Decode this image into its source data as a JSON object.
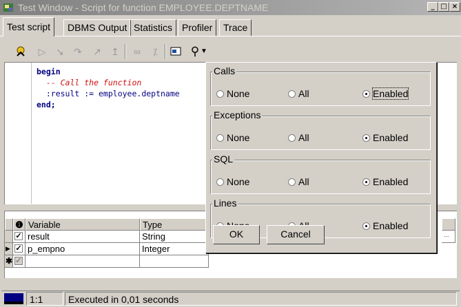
{
  "window": {
    "title": "Test Window - Script for function EMPLOYEE.DEPTNAME"
  },
  "tabs": [
    {
      "label": "Test script"
    },
    {
      "label": "DBMS Output"
    },
    {
      "label": "Statistics"
    },
    {
      "label": "Profiler"
    },
    {
      "label": "Trace"
    }
  ],
  "toolbar": {
    "icons": [
      "execute-icon",
      "run-icon",
      "step-into-icon",
      "step-over-icon",
      "step-out-icon",
      "run-to-exception-icon",
      "breakpoint-icon",
      "variables-icon",
      "trace-icon",
      "find-icon",
      "dropdown-icon"
    ]
  },
  "editor": {
    "lines": [
      {
        "text": "begin"
      },
      {
        "text": "  -- Call the function"
      },
      {
        "text": "  :result := employee.deptname"
      },
      {
        "text": "end;"
      }
    ]
  },
  "grid": {
    "header_icon": "info-icon",
    "columns": [
      "Variable",
      "Type"
    ],
    "rows": [
      {
        "variable": "result",
        "type": "String"
      },
      {
        "variable": "p_empno",
        "type": "Integer"
      }
    ]
  },
  "popup": {
    "groups": [
      {
        "title": "Calls",
        "options": [
          "None",
          "All",
          "Enabled"
        ],
        "selected": "Enabled"
      },
      {
        "title": "Exceptions",
        "options": [
          "None",
          "All",
          "Enabled"
        ],
        "selected": "Enabled"
      },
      {
        "title": "SQL",
        "options": [
          "None",
          "All",
          "Enabled"
        ],
        "selected": "Enabled"
      },
      {
        "title": "Lines",
        "options": [
          "None",
          "All",
          "Enabled"
        ],
        "selected": "Enabled"
      }
    ],
    "ok_label": "OK",
    "cancel_label": "Cancel"
  },
  "status": {
    "position": "1:1",
    "message": "Executed in 0,01 seconds"
  },
  "colors": {
    "face": "#d4d0c8",
    "keyword": "#000080",
    "comment": "#d01010"
  }
}
